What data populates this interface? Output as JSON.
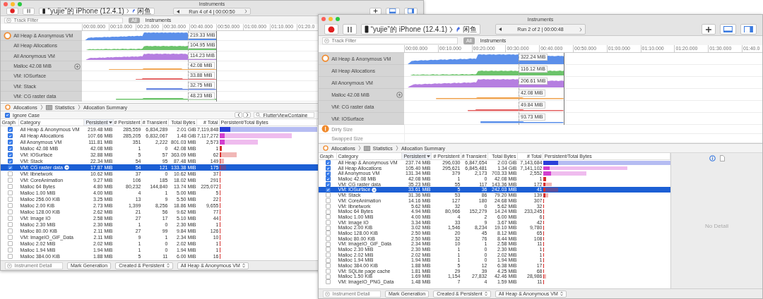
{
  "windows": [
    {
      "title": "Instruments",
      "device": "“yujie”的 iPhone (12.4.1)",
      "app": "闲鱼",
      "run": "Run 4 of 4 | 00:00:50",
      "view_toggles": [
        {
          "kind": "bottom",
          "on": true
        },
        {
          "kind": "side",
          "on": true
        }
      ],
      "filter": {
        "placeholder": "Track Filter"
      },
      "scope": "All",
      "scope_label": "Instruments",
      "ruler": [
        "00:00.000",
        "00:10.000",
        "00:20.000",
        "00:30.000",
        "00:40.000",
        "00:50.000",
        "01:00.000",
        "01:10.000",
        "01:20.0"
      ],
      "tracks": [
        {
          "name": "All Heap & Anonymous VM",
          "reading": "219.33 MiB",
          "color": "#5b8fea",
          "kind": "area",
          "instrument": true
        },
        {
          "name": "All Heap Allocations",
          "reading": "104.95 MiB",
          "color": "#6cc36b",
          "kind": "area",
          "instrument": false
        },
        {
          "name": "All Anonymous VM",
          "reading": "114.23 MiB",
          "color": "#b57ee0",
          "kind": "area",
          "instrument": false
        },
        {
          "name": "Malloc 42.08 MiB",
          "reading": "42.08 MiB",
          "color": "#f0a451",
          "kind": "line",
          "instrument": false
        },
        {
          "name": "VM: IOSurface",
          "reading": "33.88 MiB",
          "color": "#e36464",
          "kind": "line",
          "instrument": false
        },
        {
          "name": "VM: Stack",
          "reading": "32.75 MiB",
          "color": "#6f8ce2",
          "kind": "line",
          "instrument": false
        },
        {
          "name": "VM: CG raster data",
          "reading": "48.23 MiB",
          "color": "#6cc36b",
          "kind": "line",
          "instrument": false
        }
      ],
      "breadcrumb": [
        {
          "label": "Allocations",
          "kind": "instrument"
        },
        {
          "label": "Statistics",
          "kind": "statistics"
        },
        {
          "label": "Allocation Summary",
          "kind": "summary"
        }
      ],
      "options": {
        "ignore_case": {
          "label": "Ignore Case",
          "checked": true
        },
        "search": {
          "value": "FlutterViewContaine"
        }
      },
      "table": {
        "columns": [
          {
            "label": "Graph",
            "sorted": false
          },
          {
            "label": "Category",
            "sorted": false
          },
          {
            "label": "Persistent",
            "sorted": true
          },
          {
            "label": "# Persistent",
            "sorted": false
          },
          {
            "label": "# Transient",
            "sorted": false
          },
          {
            "label": "Total Bytes",
            "sorted": false
          },
          {
            "label": "# Total",
            "sorted": false
          },
          {
            "label": "Persistent/Total Bytes",
            "sorted": false
          }
        ],
        "rows": [
          {
            "checked": true,
            "selected": false,
            "category": "All Heap & Anonymous VM",
            "persistent": "219.48 MiB",
            "persistent_count": "285,559",
            "transient_count": "6,834,289",
            "total_bytes": "2.01 GiB",
            "total_count": "7,119,848",
            "color": "#2b3fd9"
          },
          {
            "checked": true,
            "selected": false,
            "category": "All Heap Allocations",
            "persistent": "107.66 MiB",
            "persistent_count": "285,205",
            "transient_count": "6,832,067",
            "total_bytes": "1.48 GiB",
            "total_count": "7,117,272",
            "color": "#d23fcf"
          },
          {
            "checked": true,
            "selected": false,
            "category": "All Anonymous VM",
            "persistent": "111.81 MiB",
            "persistent_count": "351",
            "transient_count": "2,222",
            "total_bytes": "801.03 MiB",
            "total_count": "2,573",
            "color": "#d23fcf"
          },
          {
            "checked": true,
            "selected": false,
            "category": "Malloc 42.08 MiB",
            "persistent": "42.08 MiB",
            "persistent_count": "1",
            "transient_count": "0",
            "total_bytes": "42.08 MiB",
            "total_count": "1",
            "color": "#d6302e"
          },
          {
            "checked": true,
            "selected": false,
            "category": "VM: IOSurface",
            "persistent": "32.88 MiB",
            "persistent_count": "5",
            "transient_count": "57",
            "total_bytes": "363.09 MiB",
            "total_count": "62",
            "color": "#d6302e"
          },
          {
            "checked": true,
            "selected": false,
            "category": "VM: Stack",
            "persistent": "22.34 MiB",
            "persistent_count": "54",
            "transient_count": "95",
            "total_bytes": "87.48 MiB",
            "total_count": "149",
            "color": "#d6302e"
          },
          {
            "checked": true,
            "selected": true,
            "category": "VM: CG raster data",
            "persistent": "17.87 MiB",
            "persistent_count": "54",
            "transient_count": "121",
            "total_bytes": "133.38 MiB",
            "total_count": "175",
            "color": "#d6302e"
          },
          {
            "checked": false,
            "selected": false,
            "category": "VM: libnetwork",
            "persistent": "10.62 MiB",
            "persistent_count": "37",
            "transient_count": "0",
            "total_bytes": "10.62 MiB",
            "total_count": "37",
            "color": "#d6302e"
          },
          {
            "checked": false,
            "selected": false,
            "category": "VM: CoreAnimation",
            "persistent": "9.27 MiB",
            "persistent_count": "106",
            "transient_count": "185",
            "total_bytes": "18.02 MiB",
            "total_count": "291",
            "color": "#d6302e"
          },
          {
            "checked": false,
            "selected": false,
            "category": "Malloc 64 Bytes",
            "persistent": "4.80 MiB",
            "persistent_count": "80,232",
            "transient_count": "144,840",
            "total_bytes": "13.74 MiB",
            "total_count": "225,072",
            "color": "#d6302e"
          },
          {
            "checked": false,
            "selected": false,
            "category": "Malloc 1.00 MiB",
            "persistent": "4.00 MiB",
            "persistent_count": "4",
            "transient_count": "1",
            "total_bytes": "5.00 MiB",
            "total_count": "5",
            "color": "#d6302e"
          },
          {
            "checked": false,
            "selected": false,
            "category": "Malloc 256.00 KiB",
            "persistent": "3.25 MiB",
            "persistent_count": "13",
            "transient_count": "9",
            "total_bytes": "5.50 MiB",
            "total_count": "22",
            "color": "#d6302e"
          },
          {
            "checked": false,
            "selected": false,
            "category": "Malloc 2.00 KiB",
            "persistent": "2.73 MiB",
            "persistent_count": "1,399",
            "transient_count": "8,256",
            "total_bytes": "18.86 MiB",
            "total_count": "9,655",
            "color": "#d6302e"
          },
          {
            "checked": false,
            "selected": false,
            "category": "Malloc 128.00 KiB",
            "persistent": "2.62 MiB",
            "persistent_count": "21",
            "transient_count": "56",
            "total_bytes": "9.62 MiB",
            "total_count": "77",
            "color": "#d6302e"
          },
          {
            "checked": false,
            "selected": false,
            "category": "VM: Image IO",
            "persistent": "2.58 MiB",
            "persistent_count": "27",
            "transient_count": "17",
            "total_bytes": "5.10 MiB",
            "total_count": "44",
            "color": "#d6302e"
          },
          {
            "checked": false,
            "selected": false,
            "category": "Malloc 2.30 MiB",
            "persistent": "2.30 MiB",
            "persistent_count": "1",
            "transient_count": "0",
            "total_bytes": "2.30 MiB",
            "total_count": "1",
            "color": "#d6302e"
          },
          {
            "checked": false,
            "selected": false,
            "category": "Malloc 80.00 KiB",
            "persistent": "2.11 MiB",
            "persistent_count": "27",
            "transient_count": "99",
            "total_bytes": "9.84 MiB",
            "total_count": "126",
            "color": "#d6302e"
          },
          {
            "checked": false,
            "selected": false,
            "category": "VM: ImageIO_GIF_Data",
            "persistent": "2.11 MiB",
            "persistent_count": "9",
            "transient_count": "1",
            "total_bytes": "2.34 MiB",
            "total_count": "10",
            "color": "#d6302e"
          },
          {
            "checked": false,
            "selected": false,
            "category": "Malloc 2.02 MiB",
            "persistent": "2.02 MiB",
            "persistent_count": "1",
            "transient_count": "0",
            "total_bytes": "2.02 MiB",
            "total_count": "1",
            "color": "#d6302e"
          },
          {
            "checked": false,
            "selected": false,
            "category": "Malloc 1.94 MiB",
            "persistent": "1.94 MiB",
            "persistent_count": "1",
            "transient_count": "0",
            "total_bytes": "1.94 MiB",
            "total_count": "1",
            "color": "#d6302e"
          },
          {
            "checked": false,
            "selected": false,
            "category": "Malloc 384.00 KiB",
            "persistent": "1.88 MiB",
            "persistent_count": "5",
            "transient_count": "11",
            "total_bytes": "6.00 MiB",
            "total_count": "16",
            "color": "#d6302e"
          }
        ]
      },
      "bottom": {
        "placeholder": "Instrument Detail",
        "mark_button": "Mark Generation",
        "lifespan": "Created & Persistent",
        "scope": "All Heap & Anonymous VM"
      }
    },
    {
      "title": "Instruments",
      "device": "“yujie”的 iPhone (12.4.1)",
      "app": "闲鱼",
      "run": "Run 2 of 2 | 00:00:48",
      "view_toggles": [
        {
          "kind": "bottom",
          "on": true
        },
        {
          "kind": "side",
          "on": true
        }
      ],
      "filter": {
        "placeholder": "Track Filter"
      },
      "scope": "All",
      "scope_label": "Instruments",
      "ruler": [
        "00:00.000",
        "00:10.000",
        "00:20.000",
        "00:30.000",
        "00:40.000",
        "00:50.000",
        "01:00.000",
        "01:10.000",
        "01:20.000",
        "01:30.000",
        "01:40.0"
      ],
      "tracks": [
        {
          "name": "All Heap & Anonymous VM",
          "reading": "322.24 MiB",
          "color": "#5b8fea",
          "kind": "area",
          "instrument": true
        },
        {
          "name": "All Heap Allocations",
          "reading": "116.12 MiB",
          "color": "#6cc36b",
          "kind": "area",
          "instrument": false
        },
        {
          "name": "All Anonymous VM",
          "reading": "206.61 MiB",
          "color": "#b57ee0",
          "kind": "area",
          "instrument": false
        },
        {
          "name": "Malloc 42.08 MiB",
          "reading": "42.08 MiB",
          "color": "#f0a451",
          "kind": "line",
          "instrument": false
        },
        {
          "name": "VM: CG raster data",
          "reading": "49.84 MiB",
          "color": "#e36464",
          "kind": "line",
          "instrument": false
        },
        {
          "name": "VM: IOSurface",
          "reading": "93.73 MiB",
          "color": "#5b8fea",
          "kind": "line",
          "instrument": false
        }
      ],
      "extra_tracks": [
        {
          "name": "Dirty Size",
          "instrument": true
        },
        {
          "name": "Swapped Size",
          "instrument": false
        }
      ],
      "breadcrumb": [
        {
          "label": "Allocations",
          "kind": "instrument"
        },
        {
          "label": "Statistics",
          "kind": "statistics"
        },
        {
          "label": "Allocation Summary",
          "kind": "summary"
        }
      ],
      "table": {
        "columns": [
          {
            "label": "Graph",
            "sorted": false
          },
          {
            "label": "Category",
            "sorted": false
          },
          {
            "label": "Persistent",
            "sorted": true
          },
          {
            "label": "# Persistent",
            "sorted": false
          },
          {
            "label": "# Transient",
            "sorted": false
          },
          {
            "label": "Total Bytes",
            "sorted": false
          },
          {
            "label": "# Total",
            "sorted": false
          },
          {
            "label": "Persistent/Total Bytes",
            "sorted": false
          }
        ],
        "rows": [
          {
            "checked": true,
            "selected": false,
            "category": "All Heap & Anonymous VM",
            "persistent": "237.74 MiB",
            "persistent_count": "296,030",
            "transient_count": "6,847,654",
            "total_bytes": "2.03 GiB",
            "total_count": "7,143,684",
            "color": "#2b3fd9"
          },
          {
            "checked": true,
            "selected": false,
            "category": "All Heap Allocations",
            "persistent": "105.40 MiB",
            "persistent_count": "295,621",
            "transient_count": "6,845,481",
            "total_bytes": "1.34 GiB",
            "total_count": "7,141,102",
            "color": "#d23fcf"
          },
          {
            "checked": true,
            "selected": false,
            "category": "All Anonymous VM",
            "persistent": "131.34 MiB",
            "persistent_count": "379",
            "transient_count": "2,173",
            "total_bytes": "703.33 MiB",
            "total_count": "2,552",
            "color": "#d23fcf"
          },
          {
            "checked": true,
            "selected": false,
            "category": "Malloc 42.08 MiB",
            "persistent": "42.08 MiB",
            "persistent_count": "1",
            "transient_count": "0",
            "total_bytes": "42.08 MiB",
            "total_count": "1",
            "color": "#d6302e"
          },
          {
            "checked": true,
            "selected": false,
            "category": "VM: CG raster data",
            "persistent": "35.23 MiB",
            "persistent_count": "55",
            "transient_count": "117",
            "total_bytes": "143.36 MiB",
            "total_count": "172",
            "color": "#d6302e"
          },
          {
            "checked": true,
            "selected": true,
            "category": "VM: IOSurface",
            "persistent": "33.61 MiB",
            "persistent_count": "5",
            "transient_count": "36",
            "total_bytes": "242.03 MiB",
            "total_count": "41",
            "color": "#d6302e"
          },
          {
            "checked": false,
            "selected": false,
            "category": "VM: Stack",
            "persistent": "31.36 MiB",
            "persistent_count": "53",
            "transient_count": "86",
            "total_bytes": "79.20 MiB",
            "total_count": "139",
            "color": "#d6302e"
          },
          {
            "checked": false,
            "selected": false,
            "category": "VM: CoreAnimation",
            "persistent": "14.16 MiB",
            "persistent_count": "127",
            "transient_count": "180",
            "total_bytes": "24.68 MiB",
            "total_count": "307",
            "color": "#d6302e"
          },
          {
            "checked": false,
            "selected": false,
            "category": "VM: libnetwork",
            "persistent": "5.62 MiB",
            "persistent_count": "32",
            "transient_count": "0",
            "total_bytes": "5.62 MiB",
            "total_count": "32",
            "color": "#d6302e"
          },
          {
            "checked": false,
            "selected": false,
            "category": "Malloc 64 Bytes",
            "persistent": "4.94 MiB",
            "persistent_count": "80,966",
            "transient_count": "152,279",
            "total_bytes": "14.24 MiB",
            "total_count": "233,245",
            "color": "#d6302e"
          },
          {
            "checked": false,
            "selected": false,
            "category": "Malloc 1.00 MiB",
            "persistent": "4.00 MiB",
            "persistent_count": "4",
            "transient_count": "2",
            "total_bytes": "6.00 MiB",
            "total_count": "6",
            "color": "#d6302e"
          },
          {
            "checked": false,
            "selected": false,
            "category": "VM: Image IO",
            "persistent": "3.34 MiB",
            "persistent_count": "33",
            "transient_count": "9",
            "total_bytes": "3.67 MiB",
            "total_count": "42",
            "color": "#d6302e"
          },
          {
            "checked": false,
            "selected": false,
            "category": "Malloc 2.00 KiB",
            "persistent": "3.02 MiB",
            "persistent_count": "1,546",
            "transient_count": "8,234",
            "total_bytes": "19.10 MiB",
            "total_count": "9,780",
            "color": "#d6302e"
          },
          {
            "checked": false,
            "selected": false,
            "category": "Malloc 128.00 KiB",
            "persistent": "2.50 MiB",
            "persistent_count": "20",
            "transient_count": "45",
            "total_bytes": "8.12 MiB",
            "total_count": "65",
            "color": "#d6302e"
          },
          {
            "checked": false,
            "selected": false,
            "category": "Malloc 80.00 KiB",
            "persistent": "2.50 MiB",
            "persistent_count": "32",
            "transient_count": "76",
            "total_bytes": "8.44 MiB",
            "total_count": "108",
            "color": "#d6302e"
          },
          {
            "checked": false,
            "selected": false,
            "category": "VM: ImageIO_GIF_Data",
            "persistent": "2.34 MiB",
            "persistent_count": "10",
            "transient_count": "1",
            "total_bytes": "2.58 MiB",
            "total_count": "11",
            "color": "#d6302e"
          },
          {
            "checked": false,
            "selected": false,
            "category": "Malloc 2.30 MiB",
            "persistent": "2.30 MiB",
            "persistent_count": "1",
            "transient_count": "0",
            "total_bytes": "2.30 MiB",
            "total_count": "1",
            "color": "#d6302e"
          },
          {
            "checked": false,
            "selected": false,
            "category": "Malloc 2.02 MiB",
            "persistent": "2.02 MiB",
            "persistent_count": "1",
            "transient_count": "0",
            "total_bytes": "2.02 MiB",
            "total_count": "1",
            "color": "#d6302e"
          },
          {
            "checked": false,
            "selected": false,
            "category": "Malloc 1.94 MiB",
            "persistent": "1.94 MiB",
            "persistent_count": "1",
            "transient_count": "0",
            "total_bytes": "1.94 MiB",
            "total_count": "1",
            "color": "#d6302e"
          },
          {
            "checked": false,
            "selected": false,
            "category": "Malloc 384.00 KiB",
            "persistent": "1.88 MiB",
            "persistent_count": "5",
            "transient_count": "12",
            "total_bytes": "6.38 MiB",
            "total_count": "17",
            "color": "#d6302e"
          },
          {
            "checked": false,
            "selected": false,
            "category": "VM: SQLite page cache",
            "persistent": "1.81 MiB",
            "persistent_count": "29",
            "transient_count": "39",
            "total_bytes": "4.25 MiB",
            "total_count": "68",
            "color": "#d6302e"
          },
          {
            "checked": false,
            "selected": false,
            "category": "Malloc 1.50 KiB",
            "persistent": "1.69 MiB",
            "persistent_count": "1,154",
            "transient_count": "27,832",
            "total_bytes": "42.46 MiB",
            "total_count": "28,986",
            "color": "#d6302e"
          },
          {
            "checked": false,
            "selected": false,
            "category": "VM: ImageIO_PNG_Data",
            "persistent": "1.48 MiB",
            "persistent_count": "7",
            "transient_count": "4",
            "total_bytes": "1.59 MiB",
            "total_count": "11",
            "color": "#d6302e"
          }
        ]
      },
      "detail": {
        "message": "No Detail"
      },
      "bottom": {
        "placeholder": "Instrument Detail",
        "mark_button": "Mark Generation",
        "lifespan": "Created & Persistent",
        "scope": "All Heap & Anonymous VM"
      }
    }
  ]
}
